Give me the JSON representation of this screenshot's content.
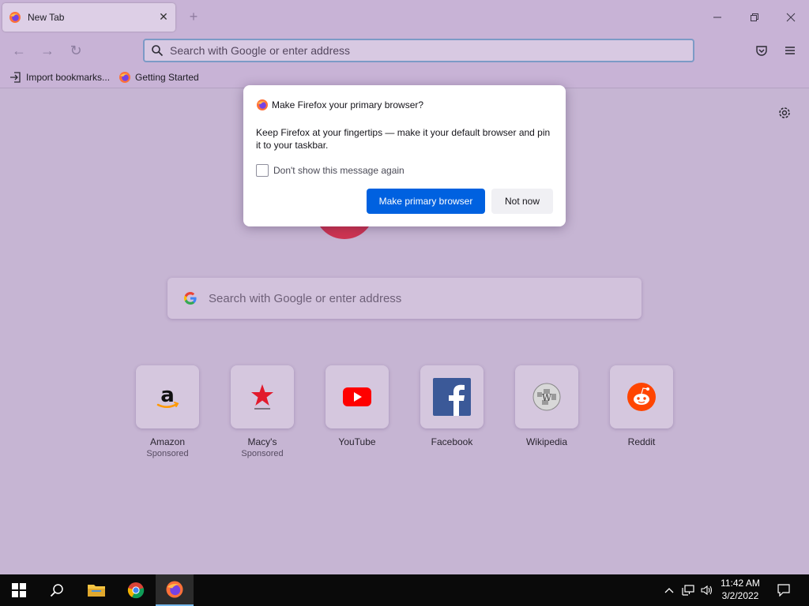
{
  "tab": {
    "title": "New Tab",
    "close": "✕"
  },
  "newtab": {
    "symbol": "+"
  },
  "window_controls": {
    "minimize": "—",
    "restore": "❐",
    "close": "✕"
  },
  "nav": {
    "back": "←",
    "forward": "→",
    "reload": "↻"
  },
  "urlbar": {
    "placeholder": "Search with Google or enter address"
  },
  "bookmarks": [
    {
      "label": "Import bookmarks..."
    },
    {
      "label": "Getting Started"
    }
  ],
  "newtab_page": {
    "search_placeholder": "Search with Google or enter address",
    "tiles": [
      {
        "label": "Amazon",
        "sub": "Sponsored"
      },
      {
        "label": "Macy's",
        "sub": "Sponsored"
      },
      {
        "label": "YouTube",
        "sub": ""
      },
      {
        "label": "Facebook",
        "sub": ""
      },
      {
        "label": "Wikipedia",
        "sub": ""
      },
      {
        "label": "Reddit",
        "sub": ""
      }
    ]
  },
  "dialog": {
    "title": "Make Firefox your primary browser?",
    "body": "Keep Firefox at your fingertips — make it your default browser and pin it to your taskbar.",
    "checkbox_label": "Don't show this message again",
    "primary_button": "Make primary browser",
    "secondary_button": "Not now"
  },
  "taskbar": {
    "time": "11:42 AM",
    "date": "3/2/2022"
  },
  "colors": {
    "accent": "#0061e0",
    "chrome_purple": "#c8b3d6"
  }
}
